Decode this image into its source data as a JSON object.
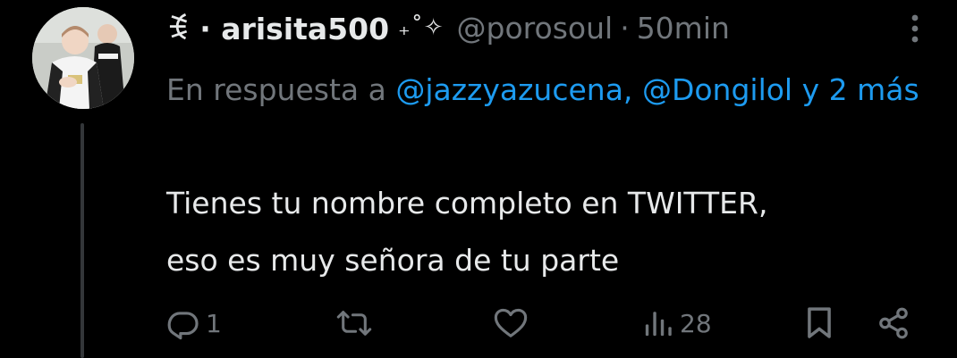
{
  "author": {
    "display_name": "ꉂ · arisita500",
    "name_decoration": "₊˚✧",
    "handle": "@porosoul",
    "separator": "·",
    "timestamp": "50min",
    "avatar": "profile-photo"
  },
  "reply_context": {
    "prefix": "En respuesta a",
    "mentions": [
      "@jazzyazucena,",
      "@Dongilol"
    ],
    "suffix": "y 2 más"
  },
  "tweet": {
    "lines": [
      "Tienes tu nombre completo en TWITTER,",
      "eso es muy señora de tu parte"
    ]
  },
  "actions": {
    "reply": {
      "icon": "reply-icon",
      "count": "1"
    },
    "retweet": {
      "icon": "retweet-icon",
      "count": ""
    },
    "like": {
      "icon": "heart-icon",
      "count": ""
    },
    "views": {
      "icon": "views-icon",
      "count": "28"
    },
    "bookmark": {
      "icon": "bookmark-icon"
    },
    "share": {
      "icon": "share-icon"
    }
  },
  "more_icon": "more-icon",
  "colors": {
    "background": "#000000",
    "text": "#e7e9ea",
    "muted": "#71767b",
    "link": "#1d9bf0",
    "thread_line": "#333639"
  }
}
